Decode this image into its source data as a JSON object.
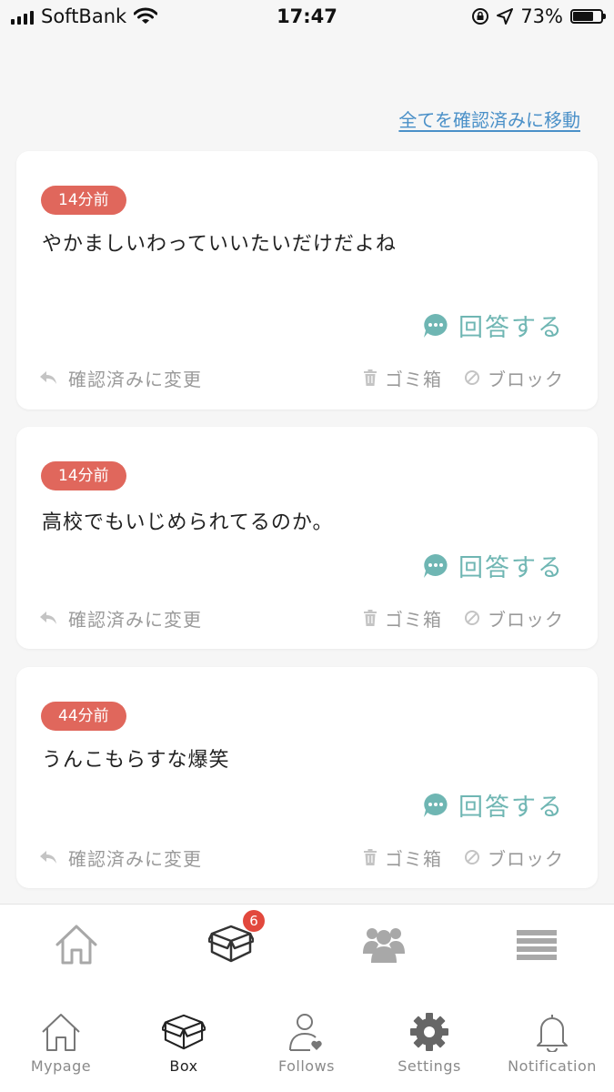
{
  "status_bar": {
    "carrier": "SoftBank",
    "time": "17:47",
    "battery": "73%",
    "battery_level": 0.73
  },
  "mark_all_link": "全てを確認済みに移動",
  "cards": [
    {
      "time": "14分前",
      "question": "やかましいわっていいたいだけだよね",
      "answer": "回答する",
      "mark_read": "確認済みに変更",
      "trash": "ゴミ箱",
      "block": "ブロック"
    },
    {
      "time": "14分前",
      "question": "高校でもいじめられてるのか。",
      "answer": "回答する",
      "mark_read": "確認済みに変更",
      "trash": "ゴミ箱",
      "block": "ブロック"
    },
    {
      "time": "44分前",
      "question": "うんこもらすな爆笑",
      "answer": "回答する",
      "mark_read": "確認済みに変更",
      "trash": "ゴミ箱",
      "block": "ブロック"
    }
  ],
  "top_tabs": {
    "box_badge": "6",
    "icons": [
      "home-icon",
      "box-icon",
      "group-icon",
      "menu-icon"
    ]
  },
  "bottom_tabs": [
    {
      "label": "Mypage",
      "icon": "home-icon"
    },
    {
      "label": "Box",
      "icon": "box-icon"
    },
    {
      "label": "Follows",
      "icon": "person-heart-icon"
    },
    {
      "label": "Settings",
      "icon": "gear-icon"
    },
    {
      "label": "Notification",
      "icon": "bell-icon"
    }
  ],
  "colors": {
    "badge": "#e0675c",
    "answer": "#6fb6b3",
    "link": "#4a90c8",
    "count_badge": "#e2483d"
  }
}
